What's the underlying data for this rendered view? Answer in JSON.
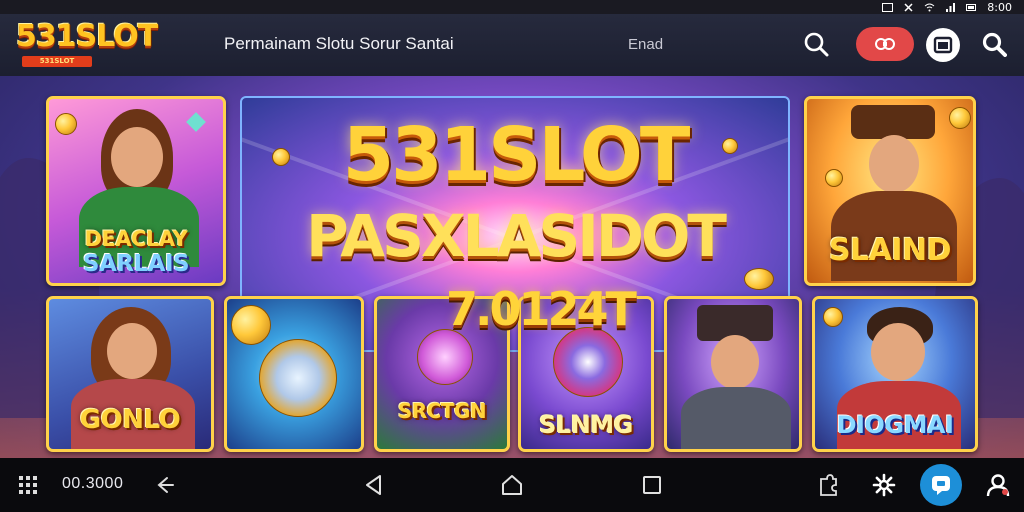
{
  "status_bar": {
    "time": "8:00"
  },
  "header": {
    "logo_text": "531SLOT",
    "logo_sub": "531SLOT",
    "tagline": "Permainam Slotu Sorur Santai",
    "email_label": "Enad"
  },
  "hero": {
    "title": "531SLOT",
    "subtitle": "PASXLASIDOT",
    "jackpot": "7.0124T"
  },
  "games": [
    {
      "label_line1": "DEACLAY",
      "label_line2": "SARLAIS"
    },
    {
      "label": "SLAIND"
    },
    {
      "label": "GONLO"
    },
    {
      "label": ""
    },
    {
      "label": "SRCTGN"
    },
    {
      "label": "SLNMG"
    },
    {
      "label": ""
    },
    {
      "label": "DIOGMAI"
    }
  ],
  "navbar": {
    "time": "00.3000"
  },
  "colors": {
    "accent": "#ffd23a",
    "promo": "#e24848",
    "active_nav": "#1d8fd8"
  }
}
